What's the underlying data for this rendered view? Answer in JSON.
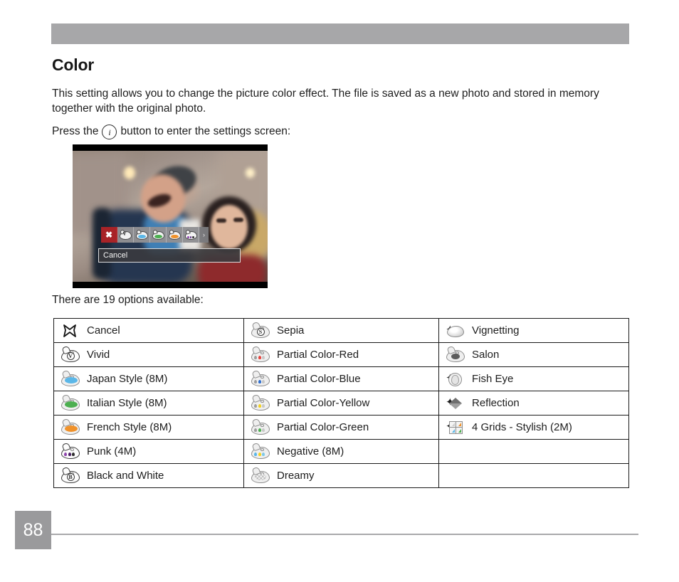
{
  "page": {
    "number": "88",
    "title": "Color"
  },
  "body": {
    "intro": "This setting allows you to change the picture color effect. The file is saved as a new photo and stored in memory together with the original photo.",
    "press_prefix": "Press the",
    "press_icon_letter": "i",
    "press_suffix": "button to enter the settings screen:",
    "options_count_text": "There are 19 options available:"
  },
  "camera_preview": {
    "selected_label": "Cancel",
    "strip_icons": [
      {
        "name": "cancel",
        "kind": "x",
        "selected": true
      },
      {
        "name": "vivid",
        "kind": "letter",
        "letter": "V"
      },
      {
        "name": "japan-style",
        "kind": "fill",
        "color": "#5bb7e8"
      },
      {
        "name": "italian-style",
        "kind": "fill",
        "color": "#4caf50"
      },
      {
        "name": "french-style",
        "kind": "fill",
        "color": "#f0922b"
      },
      {
        "name": "punk",
        "kind": "dots",
        "colors": [
          "#8e44ad",
          "#5b2d82",
          "#333333"
        ]
      }
    ],
    "next_arrow": "›"
  },
  "options_table": {
    "rows": [
      [
        {
          "label": "Cancel",
          "icon": "cancel-x-icon",
          "kind": "x"
        },
        {
          "label": "Sepia",
          "icon": "palette-sepia-icon",
          "kind": "letter",
          "letter": "S"
        },
        {
          "label": "Vignetting",
          "icon": "palette-vignetting-icon",
          "kind": "vignette"
        }
      ],
      [
        {
          "label": "Vivid",
          "icon": "palette-vivid-icon",
          "kind": "letter",
          "letter": "V",
          "dark": true
        },
        {
          "label": "Partial Color-Red",
          "icon": "palette-partial-red-icon",
          "kind": "dots",
          "colors": [
            "#9e9e9e",
            "#e8413c",
            "#c8c8c8"
          ]
        },
        {
          "label": "Salon",
          "icon": "palette-salon-icon",
          "kind": "salon"
        }
      ],
      [
        {
          "label": "Japan Style (8M)",
          "icon": "palette-japan-icon",
          "kind": "fill",
          "color": "#5bb7e8"
        },
        {
          "label": "Partial Color-Blue",
          "icon": "palette-partial-blue-icon",
          "kind": "dots",
          "colors": [
            "#9e9e9e",
            "#2f6fd0",
            "#c8c8c8"
          ]
        },
        {
          "label": "Fish Eye",
          "icon": "fish-eye-icon",
          "kind": "fisheye"
        }
      ],
      [
        {
          "label": "Italian Style (8M)",
          "icon": "palette-italian-icon",
          "kind": "fill",
          "color": "#4caf50"
        },
        {
          "label": "Partial Color-Yellow",
          "icon": "palette-partial-yellow-icon",
          "kind": "dots",
          "colors": [
            "#9e9e9e",
            "#f5d21e",
            "#c8c8c8"
          ]
        },
        {
          "label": "Reflection",
          "icon": "reflection-icon",
          "kind": "reflection"
        }
      ],
      [
        {
          "label": "French Style (8M)",
          "icon": "palette-french-icon",
          "kind": "fill",
          "color": "#f0922b"
        },
        {
          "label": "Partial Color-Green",
          "icon": "palette-partial-green-icon",
          "kind": "dots",
          "colors": [
            "#9e9e9e",
            "#4caf50",
            "#c8c8c8"
          ]
        },
        {
          "label": "4 Grids - Stylish (2M)",
          "icon": "four-grids-icon",
          "kind": "grid",
          "colors": [
            "#cfcfcf",
            "#f0922b",
            "#5bb7e8",
            "#4caf50"
          ]
        }
      ],
      [
        {
          "label": "Punk (4M)",
          "icon": "palette-punk-icon",
          "kind": "dots",
          "colors": [
            "#8e44ad",
            "#4a2063",
            "#2e2e2e"
          ],
          "dark": true
        },
        {
          "label": "Negative (8M)",
          "icon": "palette-negative-icon",
          "kind": "dots",
          "colors": [
            "#5bb7e8",
            "#f5d21e",
            "#7ec9e8"
          ]
        },
        {
          "label": "",
          "icon": "",
          "kind": "empty"
        }
      ],
      [
        {
          "label": "Black and White",
          "icon": "palette-black-white-icon",
          "kind": "letter",
          "letter": "B",
          "dark": true
        },
        {
          "label": "Dreamy",
          "icon": "palette-dreamy-icon",
          "kind": "checker"
        },
        {
          "label": "",
          "icon": "",
          "kind": "empty"
        }
      ]
    ]
  },
  "colors": {
    "banner": "#a7a7a9",
    "page_box": "#9a9a9c",
    "rule": "#a9a9ab",
    "camera_selected": "#a82327"
  }
}
